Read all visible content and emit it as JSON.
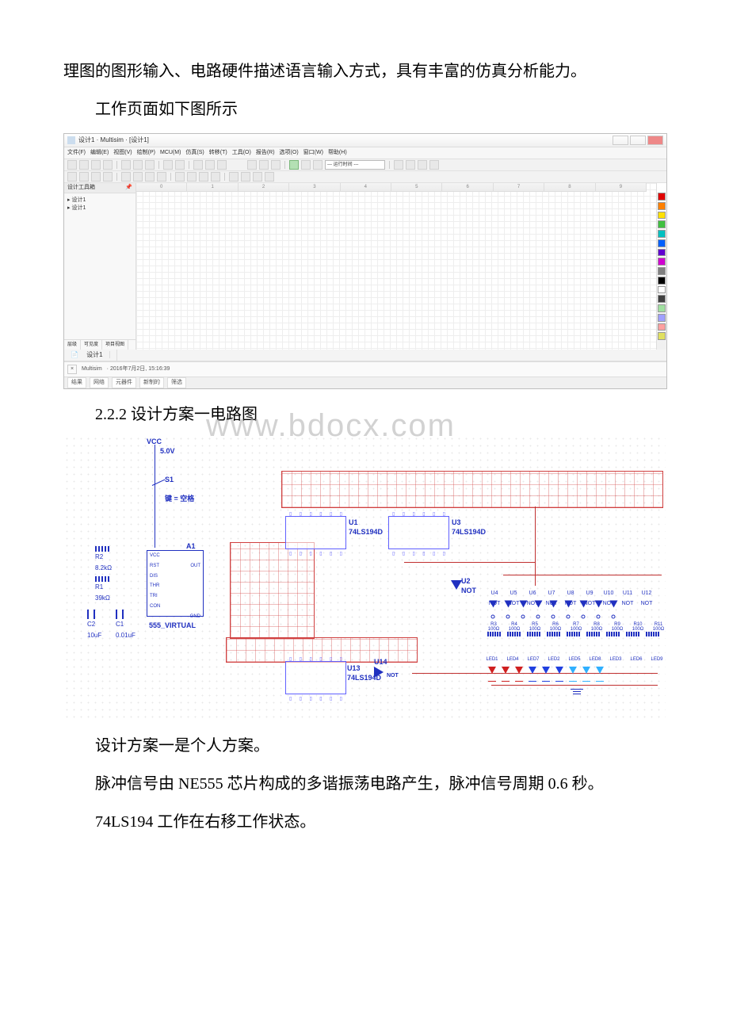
{
  "paragraphs": {
    "p1": "理图的图形输入、电路硬件描述语言输入方式，具有丰富的仿真分析能力。",
    "p2": "工作页面如下图所示",
    "section_title": "2.2.2 设计方案一电路图",
    "watermark": "www.bdocx.com",
    "p3": "设计方案一是个人方案。",
    "p4": "脉冲信号由 NE555 芯片构成的多谐振荡电路产生，脉冲信号周期 0.6 秒。",
    "p5": "74LS194 工作在右移工作状态。"
  },
  "multisim": {
    "title": "设计1 · Multisim · [设计1]",
    "menus": [
      "文件(F)",
      "编辑(E)",
      "视图(V)",
      "绘制(P)",
      "MCU(M)",
      "仿真(S)",
      "转移(T)",
      "工具(O)",
      "报告(R)",
      "选项(O)",
      "窗口(W)",
      "帮助(H)"
    ],
    "run_display": "--- 运行时间 ---",
    "left_panel_title": "设计工具箱",
    "tree": [
      "▸ 设计1",
      "  ▸ 设计1"
    ],
    "left_tabs": [
      "层级",
      "可见度",
      "项目视图"
    ],
    "tab_name": "设计1",
    "ruler": [
      "0",
      "1",
      "2",
      "3",
      "4",
      "5",
      "6",
      "7",
      "8",
      "9"
    ],
    "palette_colors": [
      "#e00000",
      "#ff8000",
      "#ffe000",
      "#40c040",
      "#00c0c0",
      "#0060ff",
      "#6000d0",
      "#d000d0",
      "#808080",
      "#000000",
      "#ffffff",
      "#404040",
      "#a0e0a0",
      "#a0a0ff",
      "#ffa0a0",
      "#e0e060"
    ],
    "log_app": "Multisim",
    "log_time": "· 2016年7月2日, 15:16:39",
    "status_buttons": [
      "结果",
      "网络",
      "元器件",
      "新制的",
      "筛选"
    ]
  },
  "circuit": {
    "vcc": "VCC",
    "vcc_val": "5.0V",
    "s1": "S1",
    "s1_key": "键 = 空格",
    "r2": "R2",
    "r2_val": "8.2kΩ",
    "r1": "R1",
    "r1_val": "39kΩ",
    "c2": "C2",
    "c2_val": "10uF",
    "c1": "C1",
    "c1_val": "0.01uF",
    "a1": "A1",
    "timer_label": "555_VIRTUAL",
    "u1": "U1",
    "u1_part": "74LS194D",
    "u3": "U3",
    "u3_part": "74LS194D",
    "u13": "U13",
    "u13_part": "74LS194D",
    "u14": "U14",
    "u14_part": "NOT",
    "u2": "U2",
    "u2_part": "NOT",
    "not_gates": [
      "U4",
      "U5",
      "U6",
      "U7",
      "U8",
      "U9",
      "U10",
      "U11",
      "U12"
    ],
    "not_label": "NOT",
    "res_row": [
      "R3",
      "R4",
      "R5",
      "R6",
      "R7",
      "R8",
      "R9",
      "R10",
      "R11"
    ],
    "res_val": "100Ω",
    "led_row": [
      "LED1",
      "LED4",
      "LED7",
      "LED2",
      "LED5",
      "LED8",
      "LED3",
      "LED6",
      "LED9"
    ],
    "led_colors": [
      "#d02020",
      "#d02020",
      "#d02020",
      "#2040e0",
      "#2040e0",
      "#2040e0",
      "#30b0ff",
      "#30b0ff",
      "#30b0ff"
    ],
    "timer_pins_left": [
      "RST",
      "DIS",
      "THR",
      "TRI",
      "CON"
    ],
    "timer_pins_top": "VCC",
    "timer_pins_right": "OUT",
    "timer_pins_bot": "GND"
  }
}
